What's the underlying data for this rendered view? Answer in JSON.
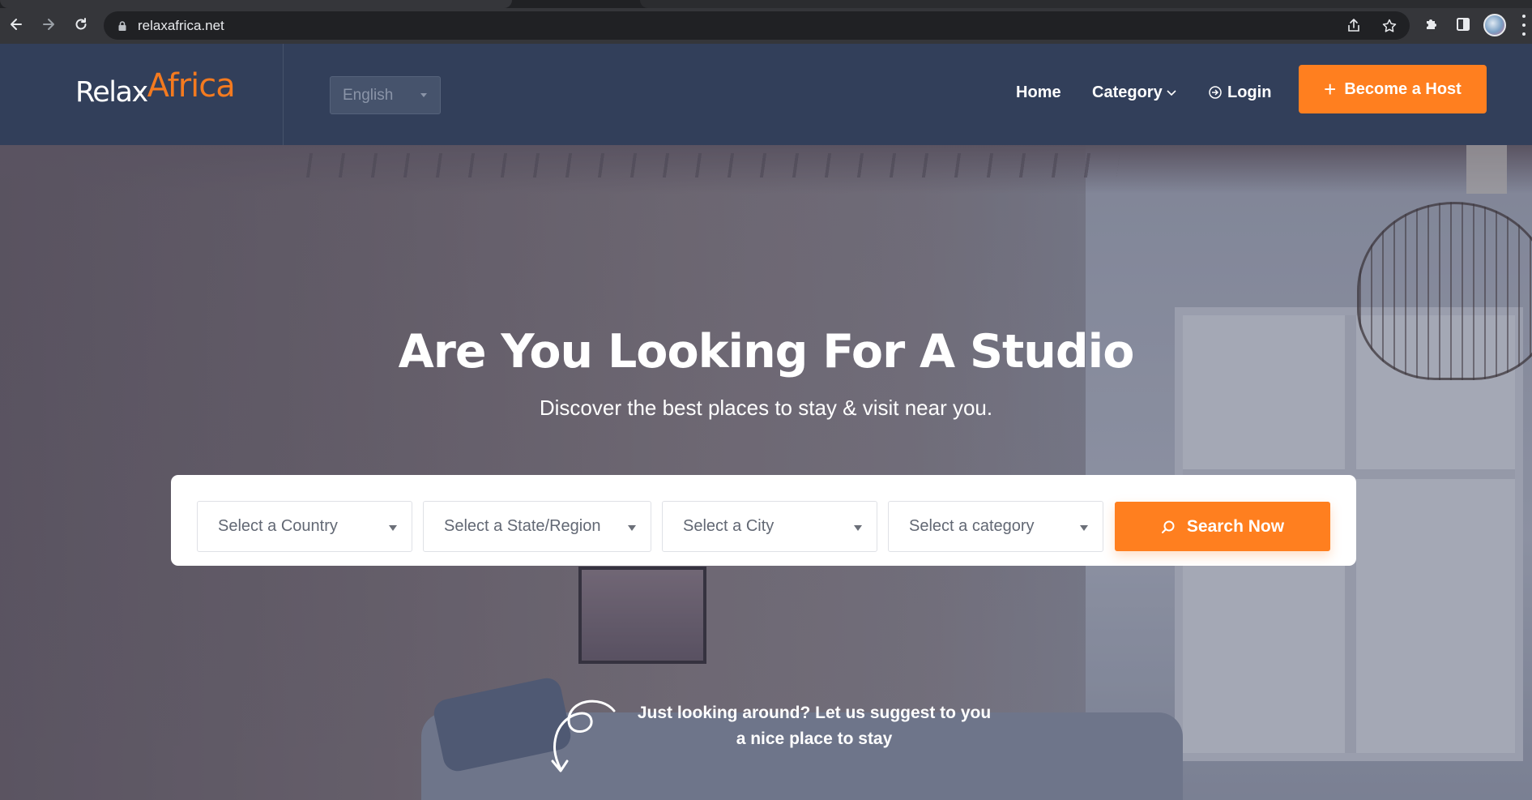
{
  "browser": {
    "url": "relaxafrica.net",
    "icons": {
      "back": "arrow-left-icon",
      "forward": "arrow-right-icon",
      "reload": "reload-icon",
      "lock": "lock-icon",
      "share": "share-icon",
      "bookmark": "star-icon",
      "extensions": "puzzle-icon",
      "side_panel": "side-panel-icon",
      "profile": "avatar",
      "menu": "kebab-menu-icon"
    }
  },
  "header": {
    "logo": {
      "part1": "Relax",
      "part2": "Africa"
    },
    "language": {
      "selected": "English"
    },
    "nav": {
      "home": "Home",
      "category": "Category",
      "login": "Login"
    },
    "host_button": {
      "plus": "+",
      "label": "Become a Host"
    },
    "colors": {
      "background": "#323f5a",
      "accent": "#ff7f1f"
    }
  },
  "hero": {
    "title": "Are You Looking For A Studio",
    "subtitle": "Discover the best places to stay & visit near you.",
    "search": {
      "country_placeholder": "Select a Country",
      "state_placeholder": "Select a State/Region",
      "city_placeholder": "Select a City",
      "category_placeholder": "Select a category",
      "button_label": "Search Now"
    },
    "suggest_line1": "Just looking around? Let us suggest to you",
    "suggest_line2": "a nice place to stay"
  }
}
